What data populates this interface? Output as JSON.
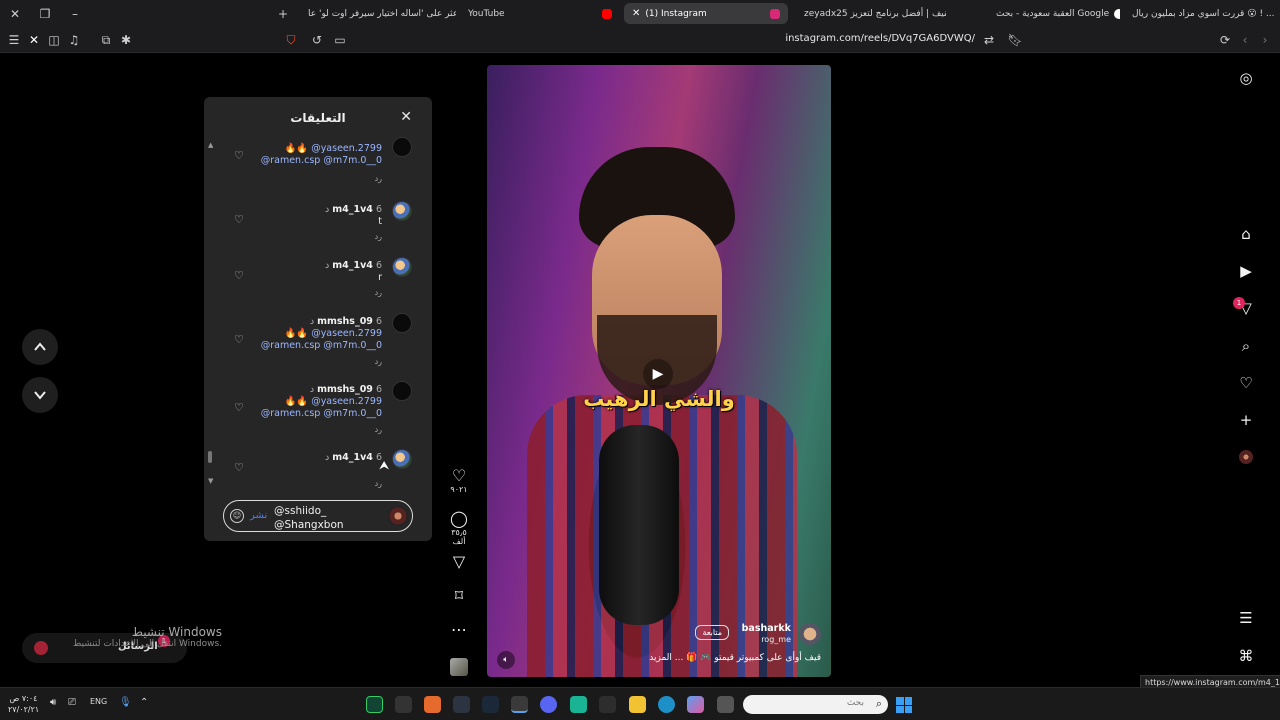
{
  "browser": {
    "tabs": [
      {
        "label": "قررت اسوي مزاد بمليون ريال 😮 ! ...",
        "favicon_color": "#e04a5a",
        "active": false
      },
      {
        "label": "العقبة سعودية - بحث Google",
        "favicon_color": "#4a8af4",
        "active": false
      },
      {
        "label": "zeyadx25 تصنيف | أفضل برنامج لتعزيز",
        "favicon_color": "#cfcfcf",
        "active": false
      },
      {
        "label": "(1) Instagram",
        "favicon_color": "#d62976",
        "active": true
      },
      {
        "label": "YouTube",
        "favicon_color": "#ff0000",
        "active": false
      },
      {
        "label": "اعثر على 'اساله اختيار سيرفر اوت لو' عا...",
        "favicon_color": "#ffffff",
        "active": false
      }
    ],
    "url": "instagram.com/reels/DVq7GA6DVWQ/",
    "status_url": "https://www.instagram.com/m4_1v4/"
  },
  "comments_panel": {
    "title": "التعليقات",
    "comments": [
      {
        "username": "",
        "time": "",
        "text_emoji": "🔥🔥",
        "mention1": "@yaseen.2799",
        "mention2": "@ramen.csp @m7m.0__0",
        "reply": "رد"
      },
      {
        "username": "m4_1v4",
        "time": "6 د",
        "text": "t",
        "reply": "رد"
      },
      {
        "username": "m4_1v4",
        "time": "6 د",
        "text": "r",
        "reply": "رد"
      },
      {
        "username": "mmshs_09",
        "time": "6 د",
        "text_emoji": "🔥🔥",
        "mention1": "@yaseen.2799",
        "mention2": "@ramen.csp @m7m.0__0",
        "reply": "رد"
      },
      {
        "username": "mmshs_09",
        "time": "6 د",
        "text_emoji": "🔥🔥",
        "mention1": "@yaseen.2799",
        "mention2": "@ramen.csp @m7m.0__0",
        "reply": "رد"
      },
      {
        "username": "m4_1v4",
        "time": "6 د",
        "text": "",
        "reply": "رد"
      }
    ],
    "compose": {
      "line1": "@sshiido_",
      "line2": "@Shangxbon",
      "post_label": "نشر"
    }
  },
  "actions": {
    "likes": "٩٠٢١",
    "comments": "٣٥٫٥ ألف"
  },
  "reel": {
    "caption": "والشي الرهيب",
    "author": "basharkk",
    "sub": "rog_me",
    "follow_label": "متابعة",
    "description": "قيف أوأى على كمبيوتر قيمتو 🎮 🎁 ... المزيد"
  },
  "right_nav": {
    "notifications_badge": "1"
  },
  "overlay": {
    "activate_title": "تنشيط Windows",
    "activate_sub": "انتقل إلى الإعدادات لتنشيط Windows.",
    "messages_label": "الرسائل",
    "messages_badge": "1"
  },
  "taskbar": {
    "time": "٧:٠٤ ص",
    "date": "٢٧/٠٢/٢١",
    "lang": "ENG",
    "search_placeholder": "بحث"
  },
  "colors": {
    "accent": "#0095f6",
    "badge": "#e0245e",
    "mention": "#9bb7ff",
    "caption": "#ffd24a"
  }
}
